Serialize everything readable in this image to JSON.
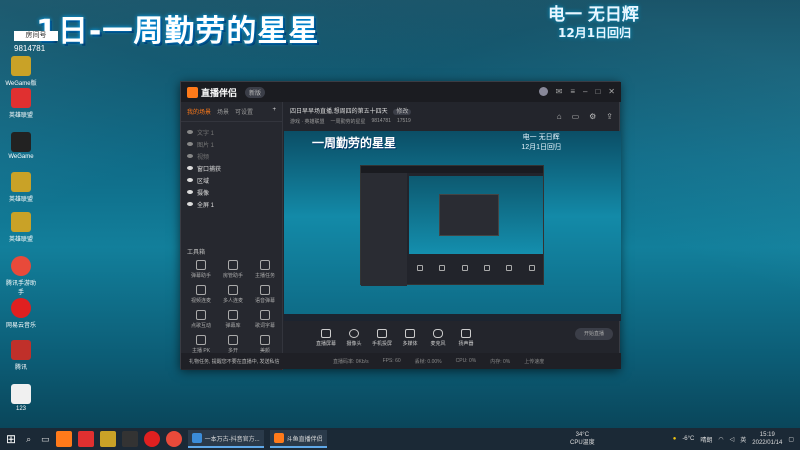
{
  "overlay": {
    "title": "1日-一周勤劳的星星",
    "room_label": "房间号",
    "room_number": "9814781",
    "right_line1": "电一 无日辉",
    "right_line2": "12月1日回归"
  },
  "desktop_icons": [
    {
      "label": "WeGame版",
      "color": "#f1c40f"
    },
    {
      "label": "英雄联盟",
      "color": "#c9a227"
    },
    {
      "label": "WeGame",
      "color": "#e03030"
    },
    {
      "label": "英雄联盟",
      "color": "#c9a227"
    },
    {
      "label": "英雄联盟",
      "color": "#c9a227"
    },
    {
      "label": "腾讯手游助手",
      "color": "#e84a3a"
    },
    {
      "label": "网易云音乐",
      "color": "#e02020"
    },
    {
      "label": "腾讯",
      "color": "#c0302a"
    },
    {
      "label": "123",
      "color": "#f0f0f0"
    }
  ],
  "app": {
    "name": "直播伴侣",
    "version": "新版",
    "side_tabs": [
      "我的场景",
      "场景",
      "可设置"
    ],
    "sources": [
      {
        "label": "文字 1",
        "on": false
      },
      {
        "label": "图片 1",
        "on": false
      },
      {
        "label": "视频",
        "on": false
      },
      {
        "label": "窗口捕获",
        "on": true
      },
      {
        "label": "区域",
        "on": true
      },
      {
        "label": "摄像",
        "on": true
      },
      {
        "label": "全屏 1",
        "on": true
      }
    ],
    "toolbox_label": "工具箱",
    "tools": [
      "弹幕助手",
      "房管助手",
      "主播任务",
      "视频连麦",
      "多人连麦",
      "语音弹幕",
      "点歌互动",
      "弹幕库",
      "歌词字幕",
      "主播 PK",
      "多开",
      "美颜"
    ],
    "stream_title": "四日早早场直播,想周四的第五十四天",
    "stream_tag": "修改",
    "stream_meta": [
      "游戏 · 英雄联盟",
      "一周勤劳的星星",
      "9814781",
      "17519"
    ],
    "preview_title": "一周勤劳的星星",
    "preview_right": [
      "电一 无日辉",
      "12月1日回归"
    ],
    "controls": [
      "直播屏幕",
      "摄像头",
      "手机投屏",
      "多媒体",
      "麦克风",
      "扬声器"
    ],
    "start_label": "开始直播",
    "status_notice": "礼物任务, 提醒您不要在直播中, 发送私信",
    "status_items": [
      "直播码率: 0Kb/s",
      "FPS: 60",
      "丢帧: 0.00%",
      "CPU: 0%",
      "内存: 0%",
      "上传速度"
    ]
  },
  "taskbar": {
    "apps": [
      {
        "label": "一本万古-抖音官方...",
        "color": "#3b8cd8"
      },
      {
        "label": "斗鱼直播伴侣",
        "color": "#ff7a1a"
      }
    ],
    "weather_temp": "34°C",
    "weather_label": "CPU温度",
    "outside": "-6°C",
    "condition": "晴朗",
    "time": "15:19",
    "date": "2022/01/14"
  }
}
